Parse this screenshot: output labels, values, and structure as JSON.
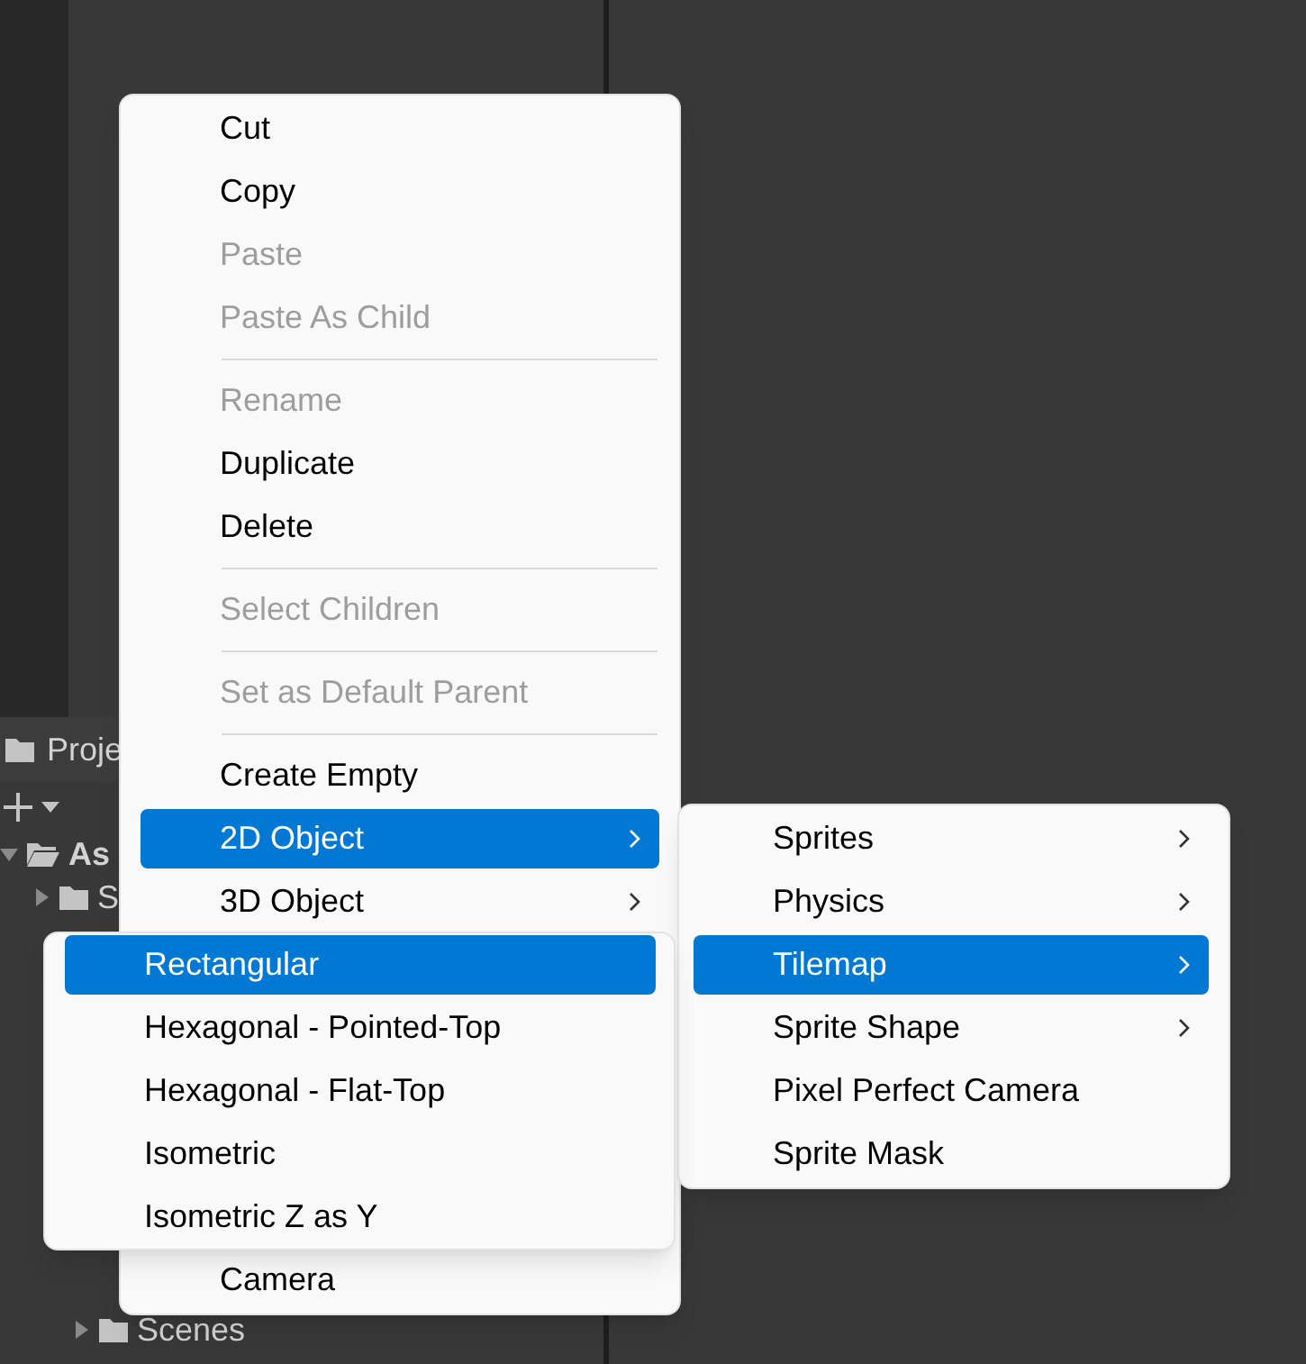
{
  "project_panel": {
    "tab": "Proje",
    "tree": [
      {
        "label": "As",
        "expanded": true,
        "bold": true
      },
      {
        "label": "S",
        "expanded": false,
        "bold": false
      },
      {
        "label": "Scenes",
        "expanded": false,
        "bold": false
      }
    ]
  },
  "context_menu": {
    "items": [
      {
        "kind": "item",
        "label": "Cut",
        "disabled": false,
        "selected": false,
        "submenu": false
      },
      {
        "kind": "item",
        "label": "Copy",
        "disabled": false,
        "selected": false,
        "submenu": false
      },
      {
        "kind": "item",
        "label": "Paste",
        "disabled": true,
        "selected": false,
        "submenu": false
      },
      {
        "kind": "item",
        "label": "Paste As Child",
        "disabled": true,
        "selected": false,
        "submenu": false
      },
      {
        "kind": "separator"
      },
      {
        "kind": "item",
        "label": "Rename",
        "disabled": true,
        "selected": false,
        "submenu": false
      },
      {
        "kind": "item",
        "label": "Duplicate",
        "disabled": false,
        "selected": false,
        "submenu": false
      },
      {
        "kind": "item",
        "label": "Delete",
        "disabled": false,
        "selected": false,
        "submenu": false
      },
      {
        "kind": "separator"
      },
      {
        "kind": "item",
        "label": "Select Children",
        "disabled": true,
        "selected": false,
        "submenu": false
      },
      {
        "kind": "separator"
      },
      {
        "kind": "item",
        "label": "Set as Default Parent",
        "disabled": true,
        "selected": false,
        "submenu": false
      },
      {
        "kind": "separator"
      },
      {
        "kind": "item",
        "label": "Create Empty",
        "disabled": false,
        "selected": false,
        "submenu": false
      },
      {
        "kind": "item",
        "label": "2D Object",
        "disabled": false,
        "selected": true,
        "submenu": true
      },
      {
        "kind": "item",
        "label": "3D Object",
        "disabled": false,
        "selected": false,
        "submenu": true
      }
    ],
    "bottom_items": [
      {
        "kind": "item",
        "label": "Camera",
        "disabled": false,
        "selected": false,
        "submenu": false
      }
    ]
  },
  "submenu_2d": {
    "items": [
      {
        "kind": "item",
        "label": "Sprites",
        "disabled": false,
        "selected": false,
        "submenu": true
      },
      {
        "kind": "item",
        "label": "Physics",
        "disabled": false,
        "selected": false,
        "submenu": true
      },
      {
        "kind": "item",
        "label": "Tilemap",
        "disabled": false,
        "selected": true,
        "submenu": true
      },
      {
        "kind": "item",
        "label": "Sprite Shape",
        "disabled": false,
        "selected": false,
        "submenu": true
      },
      {
        "kind": "item",
        "label": "Pixel Perfect Camera",
        "disabled": false,
        "selected": false,
        "submenu": false
      },
      {
        "kind": "item",
        "label": "Sprite Mask",
        "disabled": false,
        "selected": false,
        "submenu": false
      }
    ]
  },
  "submenu_tilemap": {
    "items": [
      {
        "kind": "item",
        "label": "Rectangular",
        "disabled": false,
        "selected": true,
        "submenu": false
      },
      {
        "kind": "item",
        "label": "Hexagonal - Pointed-Top",
        "disabled": false,
        "selected": false,
        "submenu": false
      },
      {
        "kind": "item",
        "label": "Hexagonal - Flat-Top",
        "disabled": false,
        "selected": false,
        "submenu": false
      },
      {
        "kind": "item",
        "label": "Isometric",
        "disabled": false,
        "selected": false,
        "submenu": false
      },
      {
        "kind": "item",
        "label": "Isometric Z as Y",
        "disabled": false,
        "selected": false,
        "submenu": false
      }
    ]
  }
}
